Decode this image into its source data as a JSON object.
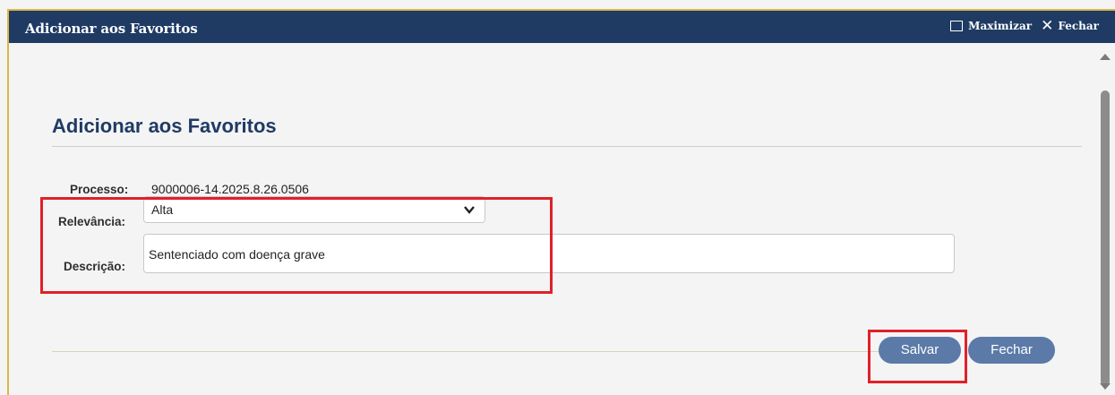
{
  "window": {
    "title": "Adicionar aos Favoritos",
    "maximize_label": "Maximizar",
    "close_label": "Fechar"
  },
  "form": {
    "heading": "Adicionar aos Favoritos",
    "processo_label": "Processo:",
    "processo_value": "9000006-14.2025.8.26.0506",
    "relevancia_label": "Relevância:",
    "relevancia_value": "Alta",
    "descricao_label": "Descrição:",
    "descricao_value": "Sentenciado com doença grave"
  },
  "buttons": {
    "save_label": "Salvar",
    "close_label": "Fechar"
  },
  "colors": {
    "titlebar": "#1f3b64",
    "button": "#5b7aa8",
    "highlight": "#e0202a"
  }
}
